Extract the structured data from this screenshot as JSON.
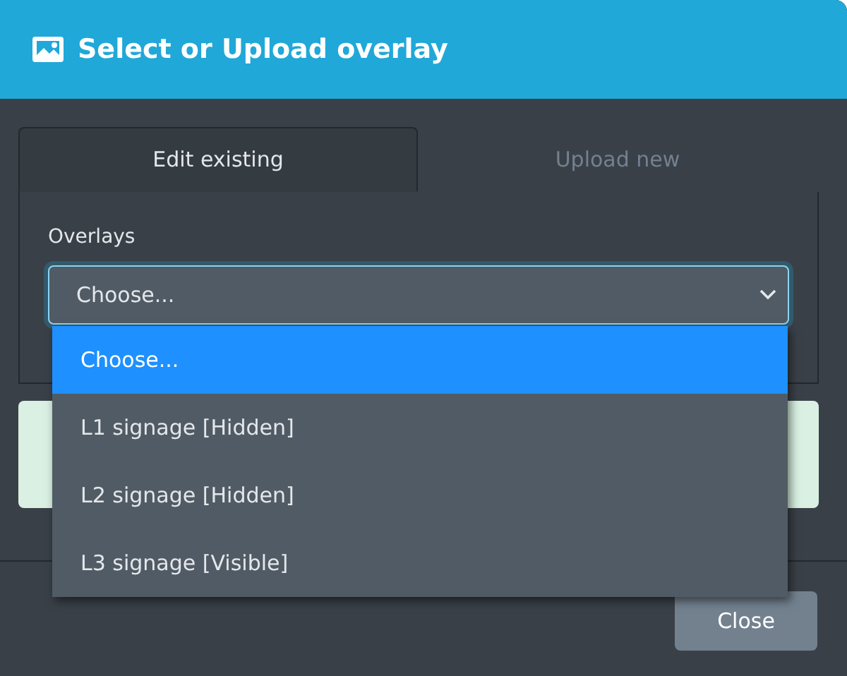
{
  "dialog": {
    "title": "Select or Upload overlay"
  },
  "tabs": [
    {
      "label": "Edit existing",
      "selected": true
    },
    {
      "label": "Upload new",
      "selected": false
    }
  ],
  "overlays_field": {
    "label": "Overlays",
    "value": "Choose...",
    "expanded": true
  },
  "dropdown_options": [
    {
      "label": "Choose...",
      "selected": true
    },
    {
      "label": "L1 signage [Hidden]",
      "selected": false
    },
    {
      "label": "L2 signage [Hidden]",
      "selected": false
    },
    {
      "label": "L3 signage [Visible]",
      "selected": false
    }
  ],
  "buttons": [
    {
      "label": "Close"
    }
  ]
}
